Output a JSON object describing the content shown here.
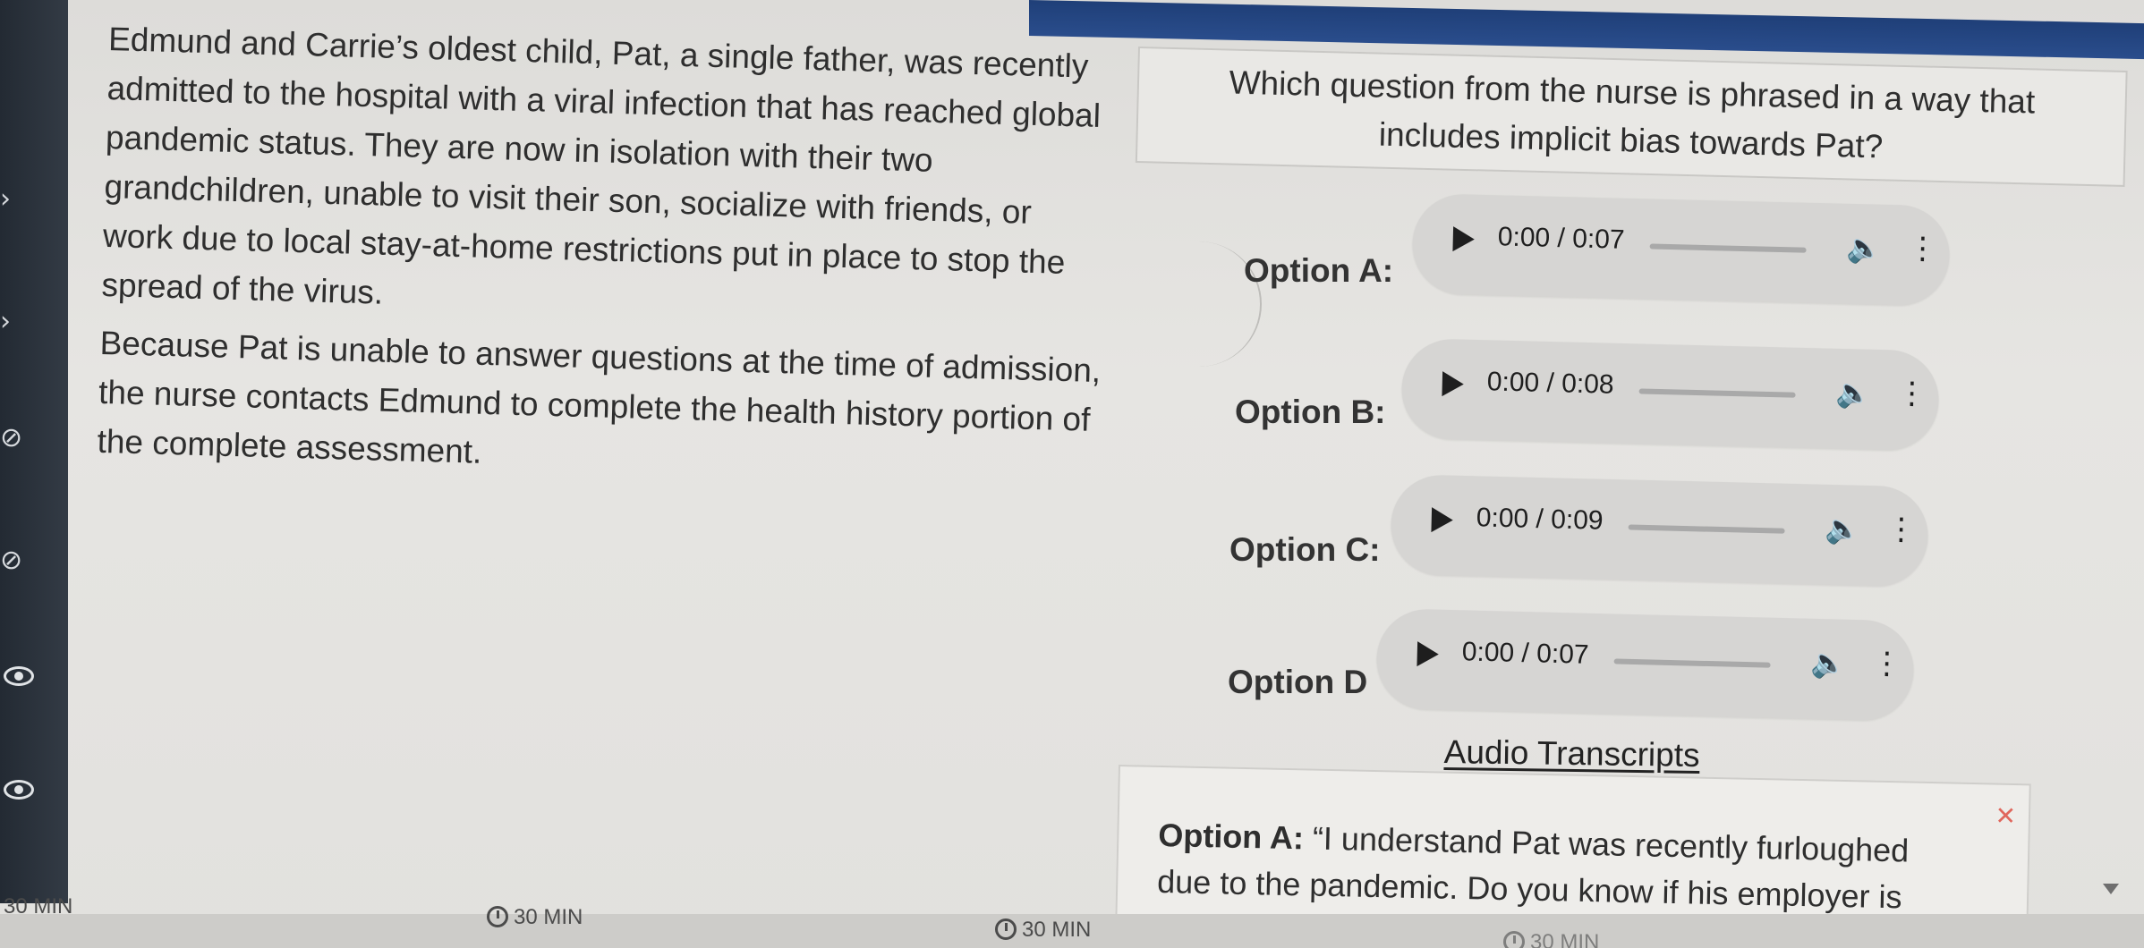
{
  "passage": {
    "paragraph1": "Edmund and Carrie’s oldest child, Pat, a single father, was recently admitted to the hospital with a viral infection that has reached global pandemic status. They are now in isolation with their two grandchildren, unable to visit their son, socialize with friends, or work due to local stay-at-home restrictions put in place to stop the spread of the virus.",
    "paragraph2": "Because Pat is unable to answer questions at the time of admission, the nurse contacts Edmund to complete the health history portion of the complete assessment."
  },
  "question": {
    "text": "Which question from the nurse is phrased in a way that includes implicit bias towards Pat?"
  },
  "options": [
    {
      "label": "Option A:",
      "time": "0:00 / 0:07",
      "progress": 0.0,
      "volume": 0.75
    },
    {
      "label": "Option B:",
      "time": "0:00 / 0:08",
      "progress": 0.0,
      "volume": 0.5
    },
    {
      "label": "Option C:",
      "time": "0:00 / 0:09",
      "progress": 0.0,
      "volume": 0.6
    },
    {
      "label": "Option D",
      "time": "0:00 / 0:07",
      "progress": 0.0,
      "volume": 0.7
    }
  ],
  "icons": {
    "play": "play-icon",
    "volume": "volume-icon",
    "more": "more-options-icon",
    "close": "close-icon"
  },
  "transcripts": {
    "link_label": "Audio Transcripts",
    "option_label": "Option A:",
    "option_text": " “I understand Pat was recently furloughed due to the pandemic. Do you know if his employer is"
  },
  "timers": {
    "t1": "30 MIN",
    "t2": "30 MIN",
    "t3": "30 MIN",
    "t4": "30 MIN"
  },
  "colors": {
    "topbar": "#2a4d8c",
    "rail": "#2b323b",
    "close": "#e0665c"
  }
}
